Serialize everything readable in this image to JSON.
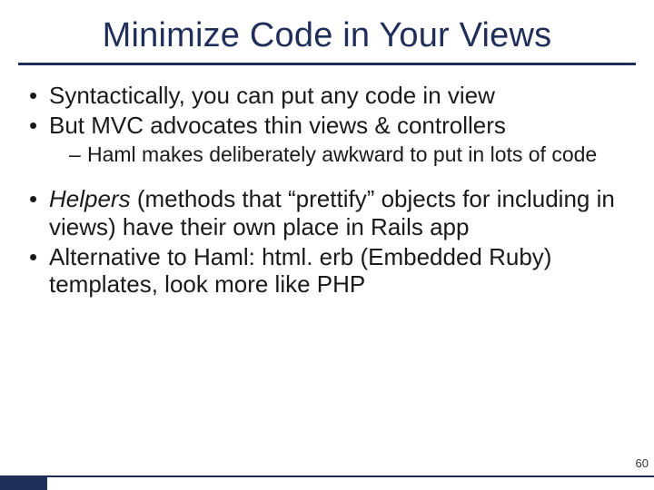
{
  "title": "Minimize Code in Your Views",
  "bullets": {
    "b1": "Syntactically, you can put any code in view",
    "b2": "But MVC advocates thin views & controllers",
    "b2_sub1": "Haml makes deliberately awkward to put in lots of code",
    "b3_emph": "Helpers",
    "b3_rest": " (methods that “prettify” objects for including in views) have their own place in Rails app",
    "b4": "Alternative to Haml: html. erb (Embedded Ruby) templates, look more like PHP"
  },
  "page_number": "60"
}
